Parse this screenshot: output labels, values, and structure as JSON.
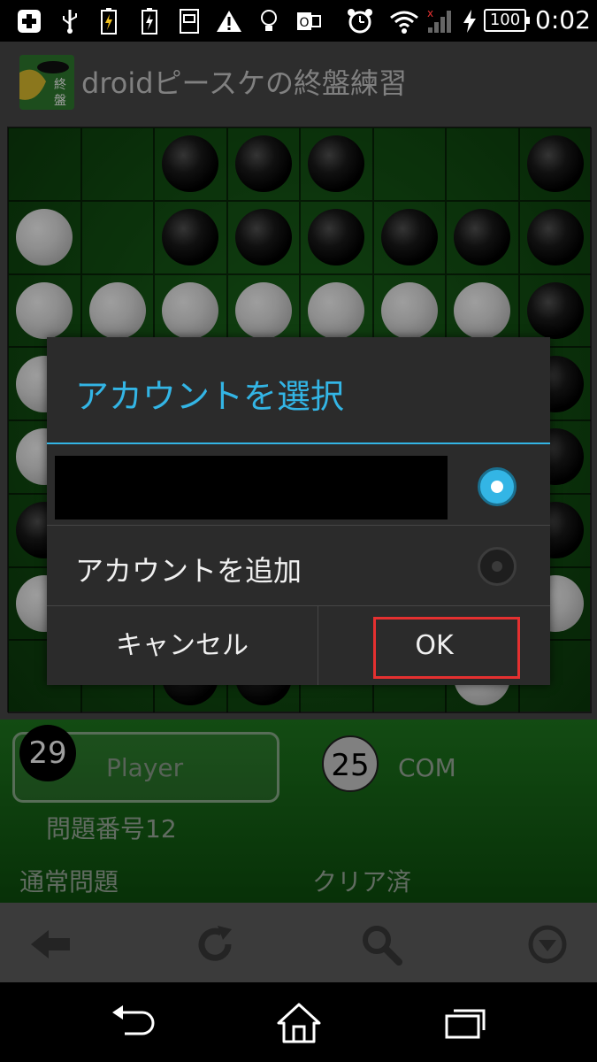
{
  "status_bar": {
    "icons": [
      "add-icon",
      "usb-icon",
      "battery-charging-icon",
      "battery-charging-icon",
      "screenshot-icon",
      "warning-icon",
      "bulb-icon",
      "outlook-icon",
      "alarm-icon",
      "wifi-icon",
      "signal-icon",
      "charging-icon"
    ],
    "battery": "100",
    "time": "0:02"
  },
  "app_bar": {
    "title": "droidピースケの終盤練習",
    "icon_text": "終盤"
  },
  "board": {
    "size": 8,
    "rows": [
      "..BBB..B",
      "W.BBBBBB",
      "WWWWWWWB",
      "WW.WWWWB",
      "WW.WWWWB",
      "B..BBBBB",
      "WWWWWWWW",
      "..BB..W."
    ]
  },
  "score": {
    "black": "29",
    "white": "25",
    "player_label": "Player",
    "com_label": "COM"
  },
  "problem": {
    "number_label": "問題番号12",
    "mode_label": "通常問題",
    "status_label": "クリア済"
  },
  "toolbar": {
    "buttons": [
      "back-arrow-icon",
      "refresh-icon",
      "search-icon",
      "dropdown-icon"
    ]
  },
  "nav": {
    "buttons": [
      "back-icon",
      "home-icon",
      "recents-icon"
    ]
  },
  "dialog": {
    "title": "アカウントを選択",
    "account_hidden": "",
    "add_account": "アカウントを追加",
    "cancel": "キャンセル",
    "ok": "OK"
  },
  "colors": {
    "accent": "#33b5e5",
    "highlight": "#e53030",
    "board_green": "#1d6a1d"
  }
}
